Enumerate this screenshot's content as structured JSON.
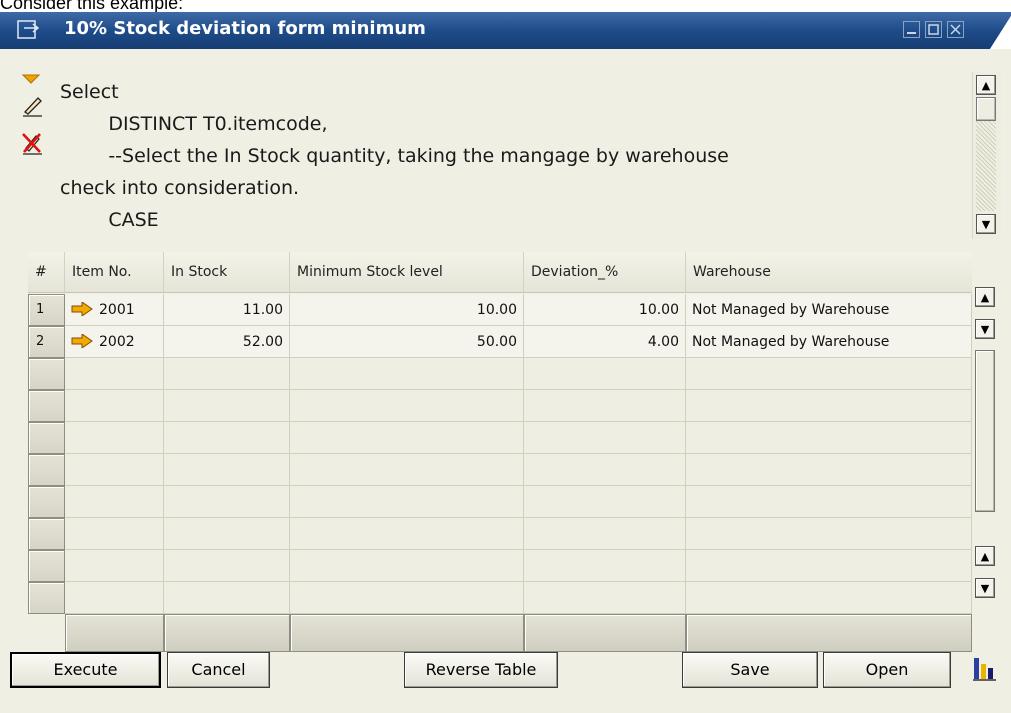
{
  "caption": "Consider this example:",
  "window": {
    "title": "10% Stock deviation form minimum"
  },
  "query": {
    "text": "Select\n\t\tDISTINCT T0.itemcode,\n\t\t--Select the In Stock quantity, taking the mangage by warehouse\ncheck into consideration.\n\t\tCASE"
  },
  "grid": {
    "columns": [
      "#",
      "Item No.",
      "In Stock",
      "Minimum Stock level",
      "Deviation_%",
      "Warehouse"
    ],
    "rows": [
      {
        "num": "1",
        "item": "2001",
        "in_stock": "11.00",
        "min_stock": "10.00",
        "deviation": "10.00",
        "warehouse": "Not Managed by Warehouse"
      },
      {
        "num": "2",
        "item": "2002",
        "in_stock": "52.00",
        "min_stock": "50.00",
        "deviation": "4.00",
        "warehouse": "Not Managed by Warehouse"
      }
    ]
  },
  "buttons": {
    "execute": "Execute",
    "cancel": "Cancel",
    "reverse_table": "Reverse Table",
    "save": "Save",
    "open": "Open"
  },
  "colors": {
    "titlebar": "#1e4c8a",
    "window_bg": "#efefe4",
    "link_arrow": "#f5a800"
  },
  "icons": {
    "title": "form-icon",
    "side": [
      "collapse-triangle-icon",
      "pencil-icon",
      "delete-query-icon"
    ],
    "link": "link-arrow-icon",
    "chart": "bar-chart-icon"
  }
}
